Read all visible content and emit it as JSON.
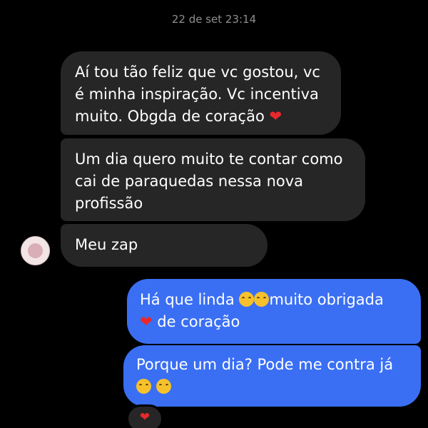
{
  "timestamp": "22 de set 23:14",
  "messages": [
    {
      "direction": "incoming",
      "lines": [
        "Aí tou tão feliz que vc gostou, vc",
        "é minha inspiração. Vc incentiva",
        "muito. Obgda de coração"
      ],
      "trailing_emoji": "red-heart"
    },
    {
      "direction": "incoming",
      "lines": [
        "Um dia quero muito te contar como",
        "cai de paraquedas nessa nova",
        "profissão"
      ]
    },
    {
      "direction": "incoming",
      "lines": [
        "Meu zap"
      ]
    },
    {
      "direction": "outgoing",
      "lines": [
        "Há que linda",
        "muito obrigada",
        "de coração"
      ],
      "emojis": [
        "smiling-face-with-hearts",
        "smiling-face-with-hearts",
        "red-heart"
      ]
    },
    {
      "direction": "outgoing",
      "lines": [
        "Porque um dia? Pode me contra já"
      ],
      "emojis": [
        "hand-over-mouth",
        "hand-over-mouth"
      ]
    }
  ],
  "reaction": {
    "emoji": "red-heart",
    "glyph": "❤"
  },
  "heart_glyph": "❤",
  "colors": {
    "background": "#000000",
    "incoming_bubble": "#262626",
    "outgoing_bubble": "#3a6ff4",
    "text": "#ffffff",
    "timestamp": "#8e8e8e",
    "heart": "#e8292c"
  }
}
